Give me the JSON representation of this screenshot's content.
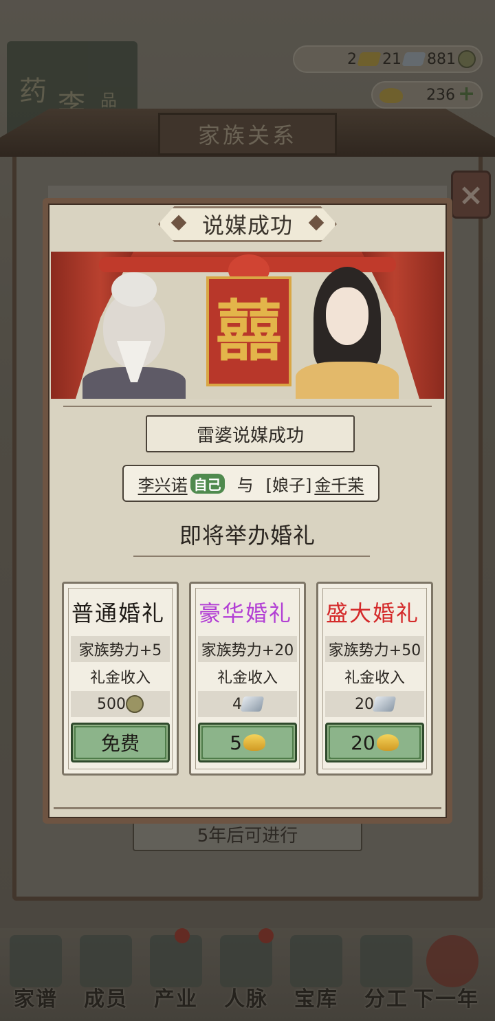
{
  "currency": {
    "gold_bars": "2",
    "silver_bars": "21",
    "coins": "881",
    "ingots": "236"
  },
  "background": {
    "shelf_chars": [
      "药",
      "李",
      "品"
    ],
    "family_panel_title": "家族关系",
    "later_button": "5年后可进行",
    "close_icon": "×"
  },
  "nav": {
    "items": [
      {
        "label": "家谱",
        "icon": "book-icon"
      },
      {
        "label": "成员",
        "icon": "person-icon"
      },
      {
        "label": "产业",
        "icon": "building-icon"
      },
      {
        "label": "人脉",
        "icon": "network-icon"
      },
      {
        "label": "宝库",
        "icon": "chest-icon"
      },
      {
        "label": "分工",
        "icon": "scroll-icon"
      },
      {
        "label": "下一年",
        "icon": "lantern-icon"
      }
    ]
  },
  "dialog": {
    "title": "说媒成功",
    "xi_char": "囍",
    "subtitle": "雷婆说媒成功",
    "couple": {
      "self_name": "李兴诺",
      "self_badge": "自己",
      "connector": "与",
      "spouse_prefix": "[娘子]",
      "spouse_name": "金千茉"
    },
    "heading": "即将举办婚礼",
    "cards": [
      {
        "title": "普通婚礼",
        "title_color": "#1e1a16",
        "effect": "家族势力+5",
        "income_label": "礼金收入",
        "income_value": "500",
        "income_icon": "coin-icon",
        "price": "免费",
        "price_icon": ""
      },
      {
        "title": "豪华婚礼",
        "title_color": "#b23fd4",
        "effect": "家族势力+20",
        "income_label": "礼金收入",
        "income_value": "4",
        "income_icon": "silver-icon",
        "price": "5",
        "price_icon": "gold-ingot-icon"
      },
      {
        "title": "盛大婚礼",
        "title_color": "#d42a2a",
        "effect": "家族势力+50",
        "income_label": "礼金收入",
        "income_value": "20",
        "income_icon": "silver-icon",
        "price": "20",
        "price_icon": "gold-ingot-icon"
      }
    ]
  }
}
